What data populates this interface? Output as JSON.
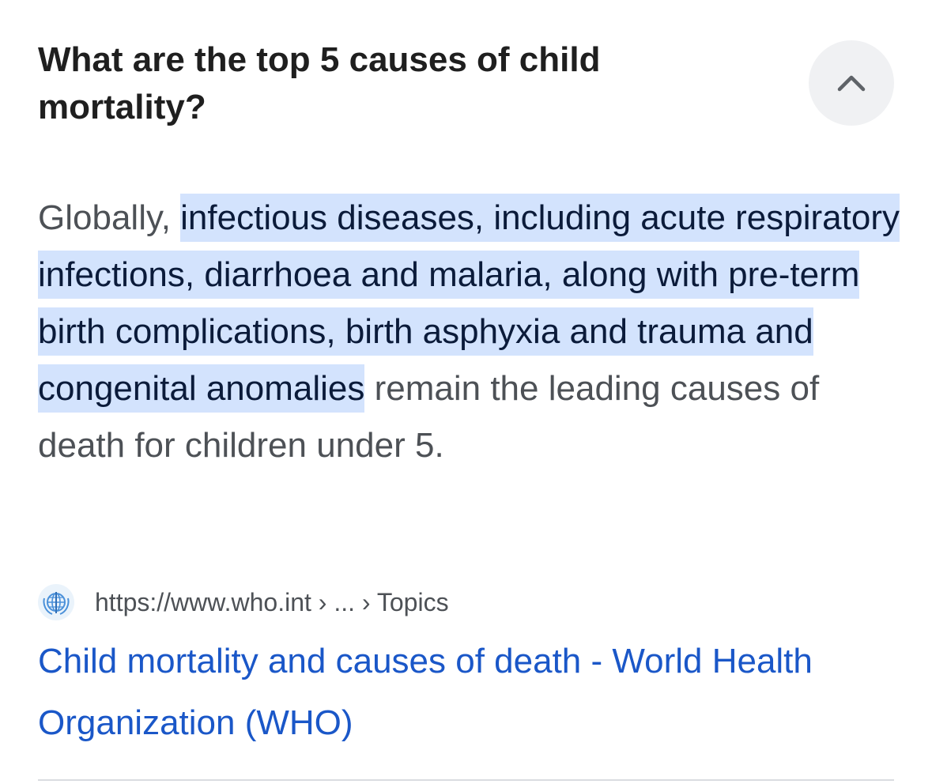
{
  "question": {
    "text": "What are the top 5 causes of child mortality?",
    "toggle_icon": "chevron-up-icon"
  },
  "answer": {
    "prefix": "Globally, ",
    "highlight": "infectious diseases, including acute respiratory infections, diarrhoea and malaria, along with pre-term birth complications, birth asphyxia and trauma and congenital anomalies",
    "suffix": " remain the leading causes of death for children under 5."
  },
  "source": {
    "favicon_icon": "who-globe-icon",
    "url": "https://www.who.int › ... › Topics",
    "title": "Child mortality and causes of death - World Health Organization (WHO)"
  },
  "colors": {
    "highlight_bg": "#d3e3fd",
    "link": "#1a57c8",
    "question_text": "#1f1f1f",
    "body_text": "#4d5156"
  }
}
